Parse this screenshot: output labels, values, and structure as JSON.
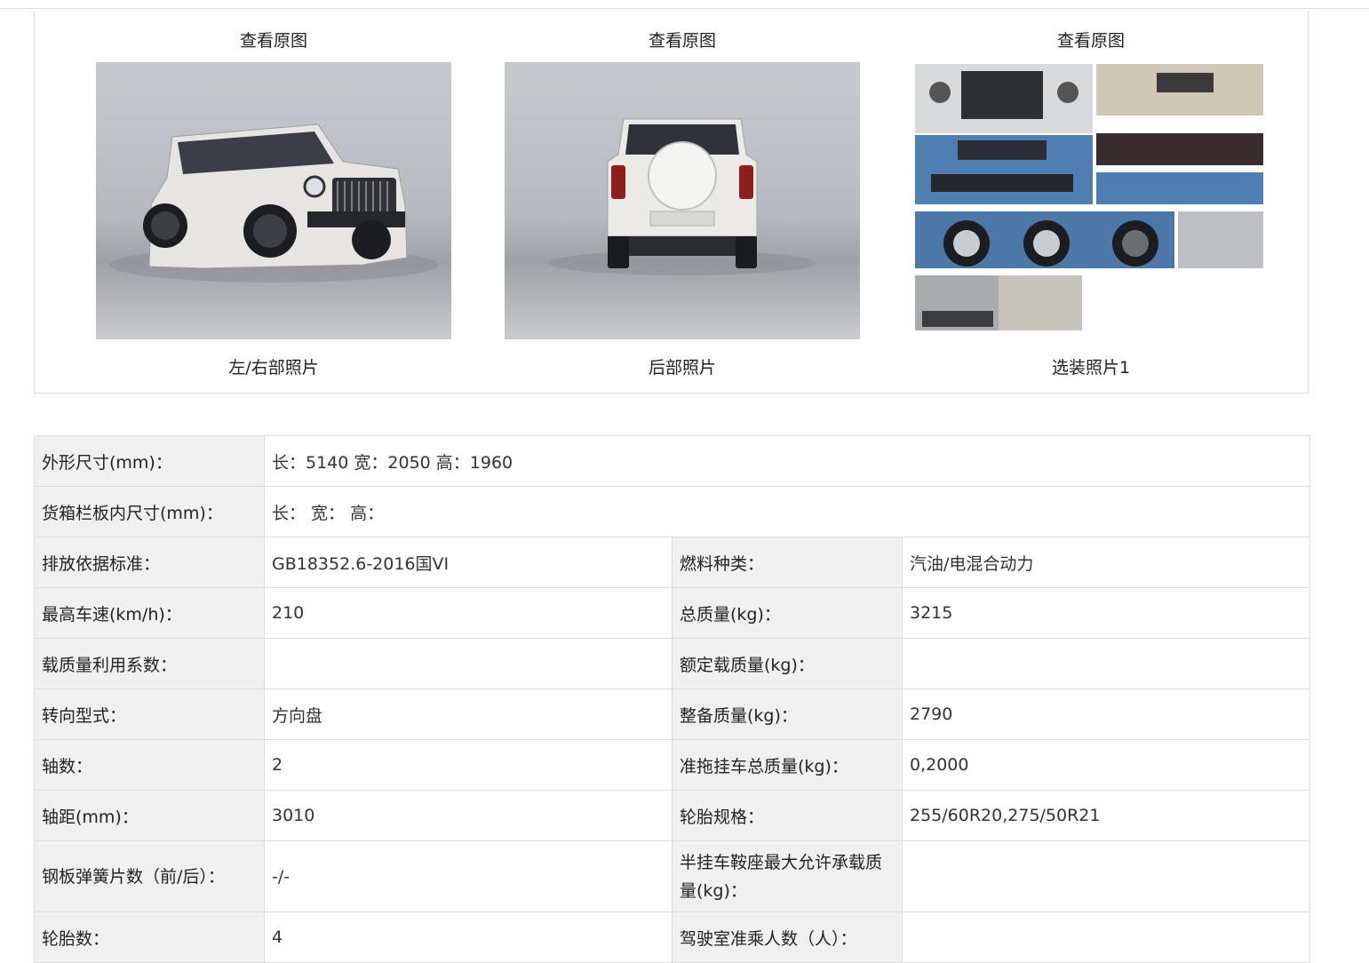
{
  "photos": [
    {
      "view_label": "查看原图",
      "caption": "左/右部照片"
    },
    {
      "view_label": "查看原图",
      "caption": "后部照片"
    },
    {
      "view_label": "查看原图",
      "caption": "选装照片1"
    }
  ],
  "specs": {
    "dims_label": "外形尺寸(mm)：",
    "dims_value": "长：5140 宽：2050 高：1960",
    "cargo_label": "货箱栏板内尺寸(mm)：",
    "cargo_value": "长：  宽：  高：",
    "rows": [
      {
        "l1": "排放依据标准：",
        "v1": "GB18352.6-2016国VI",
        "l2": "燃料种类：",
        "v2": "汽油/电混合动力"
      },
      {
        "l1": "最高车速(km/h)：",
        "v1": "210",
        "l2": "总质量(kg)：",
        "v2": "3215"
      },
      {
        "l1": "载质量利用系数：",
        "v1": "",
        "l2": "额定载质量(kg)：",
        "v2": ""
      },
      {
        "l1": "转向型式：",
        "v1": "方向盘",
        "l2": "整备质量(kg)：",
        "v2": "2790"
      },
      {
        "l1": "轴数：",
        "v1": "2",
        "l2": "准拖挂车总质量(kg)：",
        "v2": "0,2000"
      },
      {
        "l1": "轴距(mm)：",
        "v1": "3010",
        "l2": "轮胎规格：",
        "v2": "255/60R20,275/50R21"
      },
      {
        "l1": "钢板弹簧片数（前/后）：",
        "v1": "-/-",
        "l2": "半挂车鞍座最大允许承载质量(kg)：",
        "v2": ""
      },
      {
        "l1": "轮胎数：",
        "v1": "4",
        "l2": "驾驶室准乘人数（人）：",
        "v2": ""
      }
    ]
  },
  "colors": {
    "label_bg": "#f0f0f0",
    "border": "#dddddd",
    "car_body": "#e9e8e4",
    "car_blue": "#4f7fb0"
  }
}
